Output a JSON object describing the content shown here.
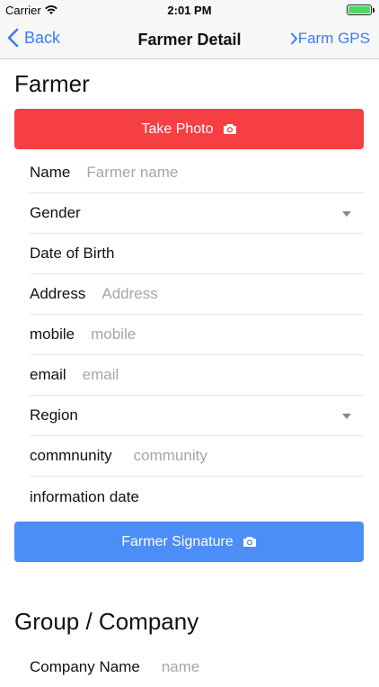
{
  "status": {
    "carrier": "Carrier",
    "time": "2:01 PM"
  },
  "nav": {
    "back_label": "Back",
    "title": "Farmer Detail",
    "right_label": "Farm GPS"
  },
  "farmer": {
    "section_title": "Farmer",
    "take_photo_label": "Take Photo",
    "fields": {
      "name": {
        "label": "Name",
        "placeholder": "Farmer name"
      },
      "gender": {
        "label": "Gender"
      },
      "dob": {
        "label": "Date of Birth"
      },
      "address": {
        "label": "Address",
        "placeholder": "Address"
      },
      "mobile": {
        "label": "mobile",
        "placeholder": "mobile"
      },
      "email": {
        "label": "email",
        "placeholder": "email"
      },
      "region": {
        "label": "Region"
      },
      "community": {
        "label": "commnunity",
        "placeholder": "community"
      },
      "info_date": {
        "label": "information date"
      }
    },
    "signature_label": "Farmer Signature"
  },
  "group": {
    "section_title": "Group / Company",
    "company_name": {
      "label": "Company Name",
      "placeholder": "name"
    }
  },
  "colors": {
    "accent": "#3a7ef0",
    "photo_button": "#f63f43",
    "signature_button": "#4b8ef7",
    "battery": "#4cd964"
  }
}
